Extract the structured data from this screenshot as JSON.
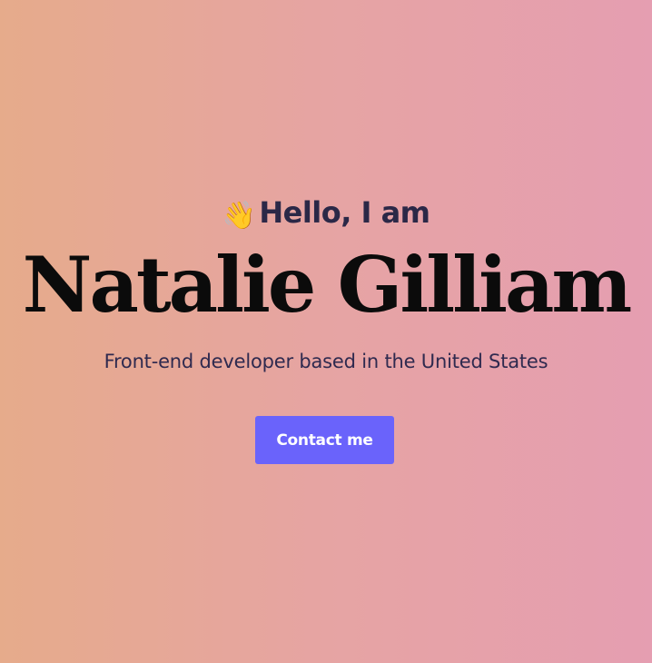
{
  "hero": {
    "greeting_emoji": "👋",
    "greeting_text": "Hello, I am",
    "name": "Natalie Gilliam",
    "subtitle": "Front-end developer based in the United States",
    "contact_label": "Contact me"
  },
  "colors": {
    "background_left": "#e6ab8b",
    "background_right": "#e59eb1",
    "greeting_text": "#2b2847",
    "name_text": "#0b0b0b",
    "subtitle_text": "#2f2a4f",
    "button_background": "#6a63fb",
    "button_text": "#ffffff"
  },
  "icons": {
    "greeting_icon": "waving-hand-icon"
  }
}
